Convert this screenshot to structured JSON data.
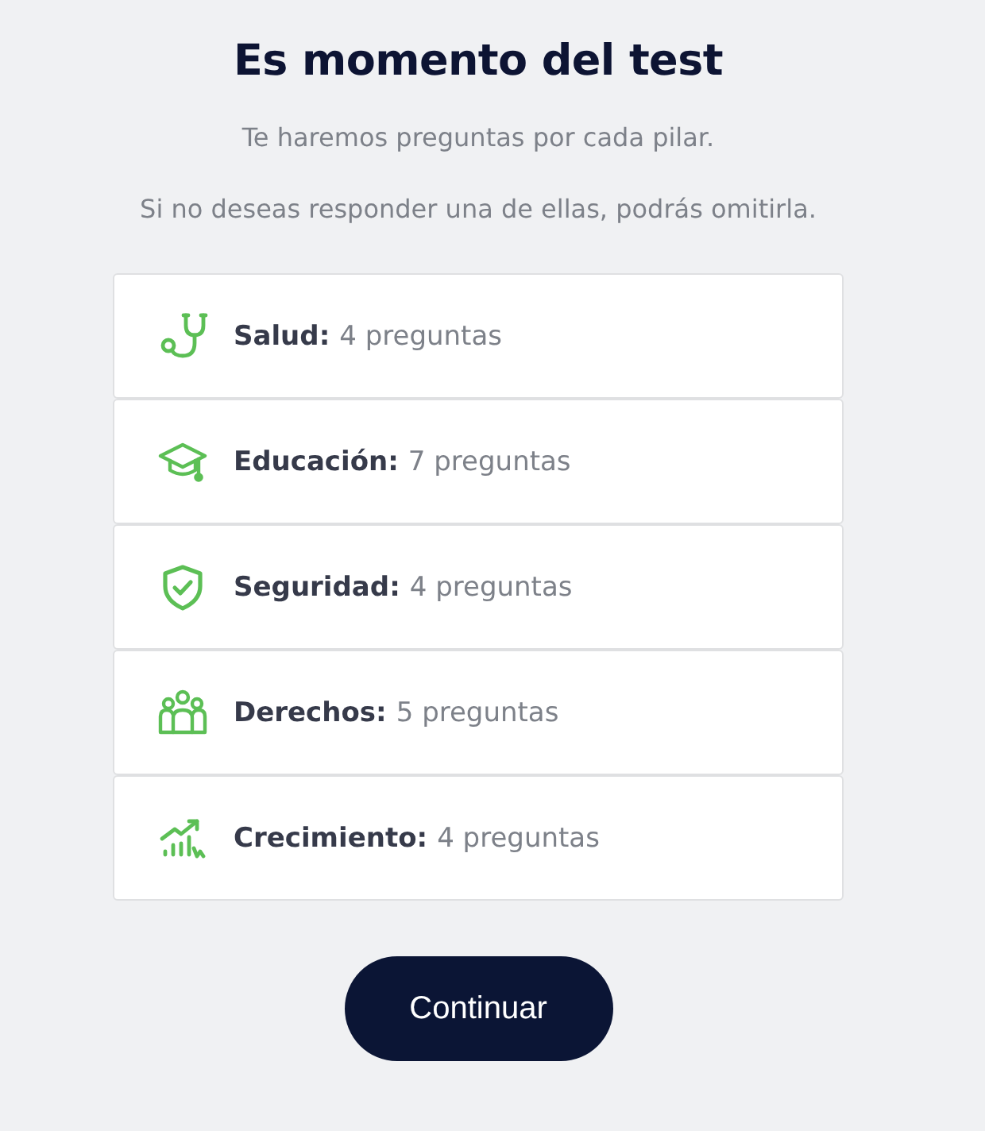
{
  "title": "Es momento del test",
  "intro": [
    "Te haremos preguntas por cada pilar.",
    "Si no deseas responder una de ellas, podrás omitirla."
  ],
  "pillars": [
    {
      "kind": "health",
      "label": "Salud:",
      "count": "4 preguntas"
    },
    {
      "kind": "education",
      "label": "Educación:",
      "count": "7 preguntas"
    },
    {
      "kind": "security",
      "label": "Seguridad:",
      "count": "4 preguntas"
    },
    {
      "kind": "rights",
      "label": "Derechos:",
      "count": "5 preguntas"
    },
    {
      "kind": "growth",
      "label": "Crecimiento:",
      "count": "4 preguntas"
    }
  ],
  "button": "Continuar"
}
